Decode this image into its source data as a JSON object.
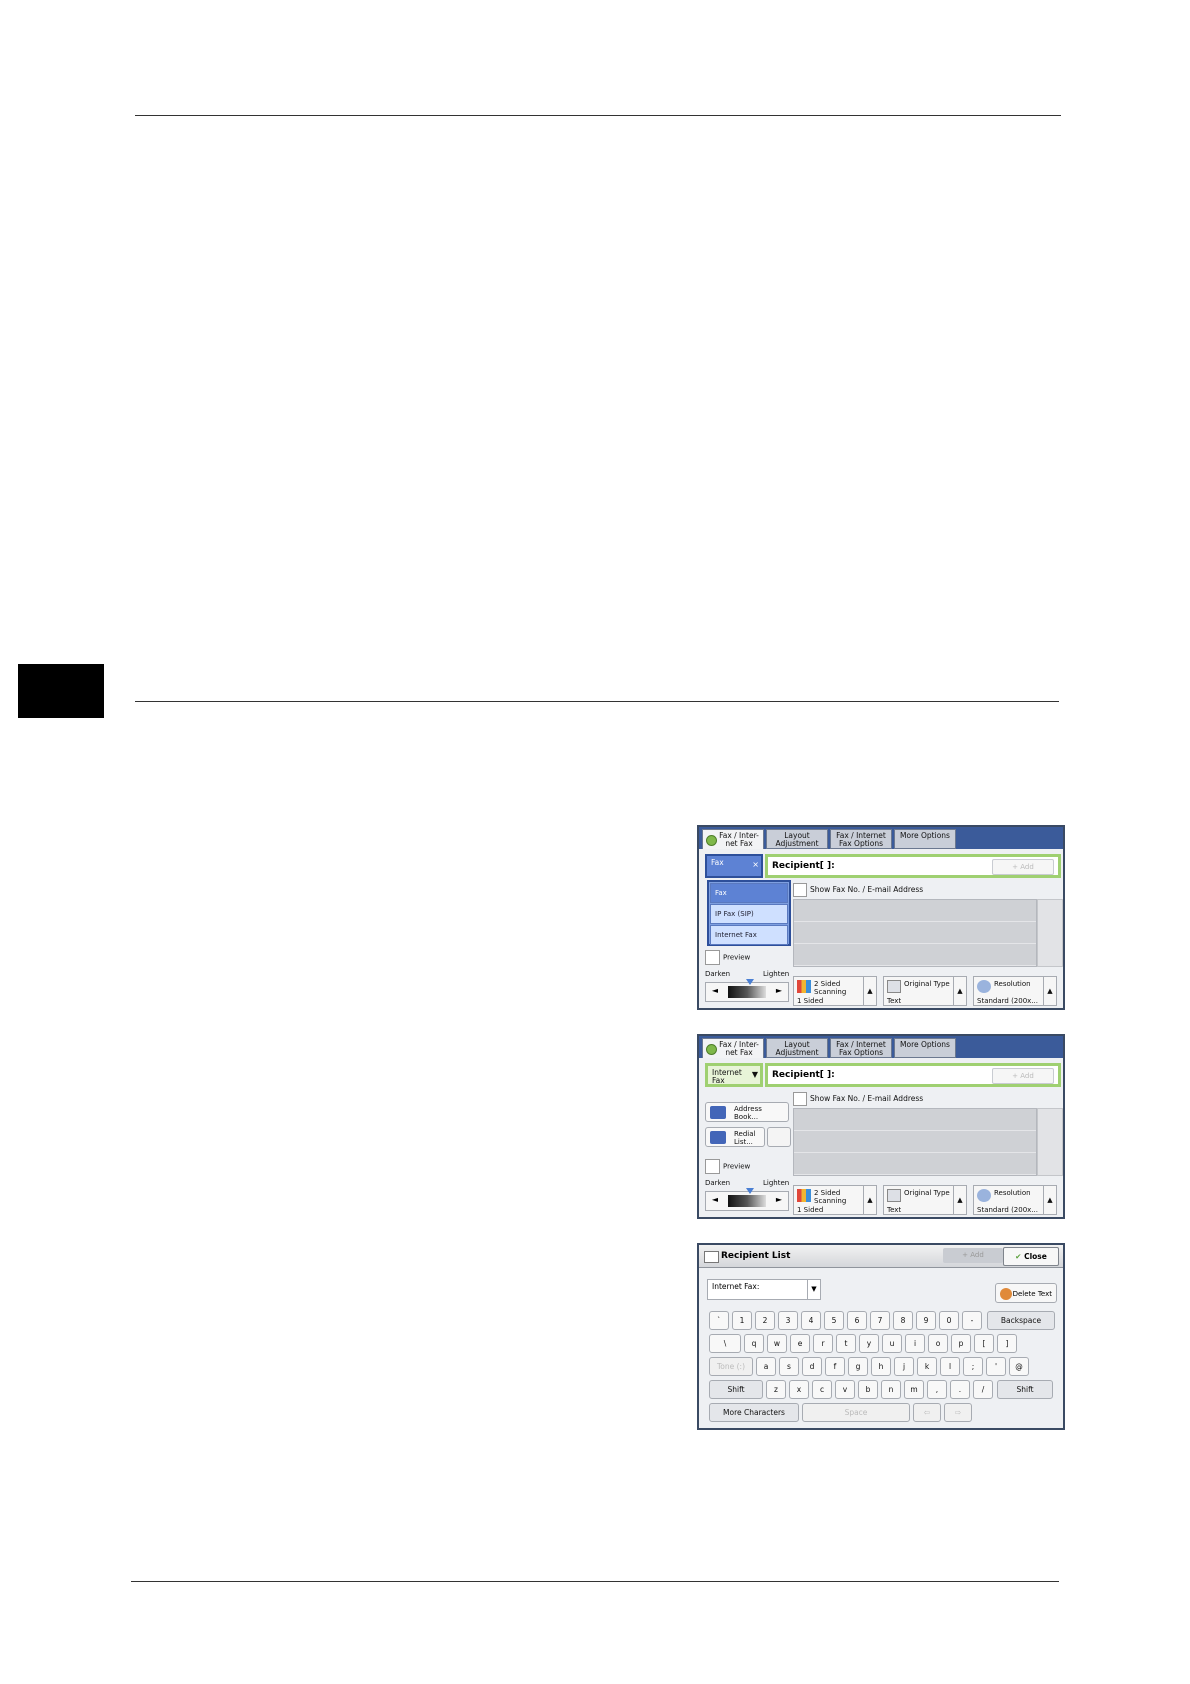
{
  "screens": {
    "dial_type_list": {
      "tabs": [
        "Fax / Inter-\nnet Fax",
        "Layout\nAdjustment",
        "Fax / Internet\nFax Options",
        "More Options"
      ],
      "dial_type_value": "Fax",
      "clear_symbol": "×",
      "recipient_label": "Recipient[    ]:",
      "add_label": "+ Add",
      "show_fax_no": "Show Fax No. / E-mail Address",
      "options": [
        "Fax",
        "IP Fax (SIP)",
        "Internet Fax"
      ],
      "preview": "Preview",
      "darken": "Darken",
      "lighten": "Lighten",
      "two_sided": {
        "label": "2 Sided\nScanning",
        "value": "1 Sided"
      },
      "original_type": {
        "label": "Original Type",
        "value": "Text"
      },
      "resolution": {
        "label": "Resolution",
        "value": "Standard (200x..."
      }
    },
    "internet_fax": {
      "tabs": [
        "Fax / Inter-\nnet Fax",
        "Layout\nAdjustment",
        "Fax / Internet\nFax Options",
        "More Options"
      ],
      "dial_type_value": "Internet\nFax",
      "recipient_label": "Recipient[    ]:",
      "add_label": "+ Add",
      "show_fax_no": "Show Fax No. / E-mail Address",
      "address_book": "Address\nBook...",
      "redial_list": "Redial\nList...",
      "preview": "Preview",
      "darken": "Darken",
      "lighten": "Lighten",
      "two_sided": {
        "label": "2 Sided\nScanning",
        "value": "1 Sided"
      },
      "original_type": {
        "label": "Original Type",
        "value": "Text"
      },
      "resolution": {
        "label": "Resolution",
        "value": "Standard (200x..."
      }
    },
    "recipient_list": {
      "title": "Recipient List",
      "add_label": "+ Add",
      "close_label": "Close",
      "type_value": "Internet Fax:",
      "delete_text": "Delete Text",
      "row1": [
        "`",
        "1",
        "2",
        "3",
        "4",
        "5",
        "6",
        "7",
        "8",
        "9",
        "0",
        "-"
      ],
      "backspace": "Backspace",
      "row2": [
        "\\",
        "q",
        "w",
        "e",
        "r",
        "t",
        "y",
        "u",
        "i",
        "o",
        "p",
        "[",
        "]"
      ],
      "tone": "Tone (:)",
      "row3": [
        "a",
        "s",
        "d",
        "f",
        "g",
        "h",
        "j",
        "k",
        "l",
        ";",
        "'",
        "@"
      ],
      "shift": "Shift",
      "row4": [
        "z",
        "x",
        "c",
        "v",
        "b",
        "n",
        "m",
        ",",
        ".",
        "/"
      ],
      "more_characters": "More Characters",
      "space": "Space",
      "left_arrow": "⇦",
      "right_arrow": "⇨"
    }
  }
}
